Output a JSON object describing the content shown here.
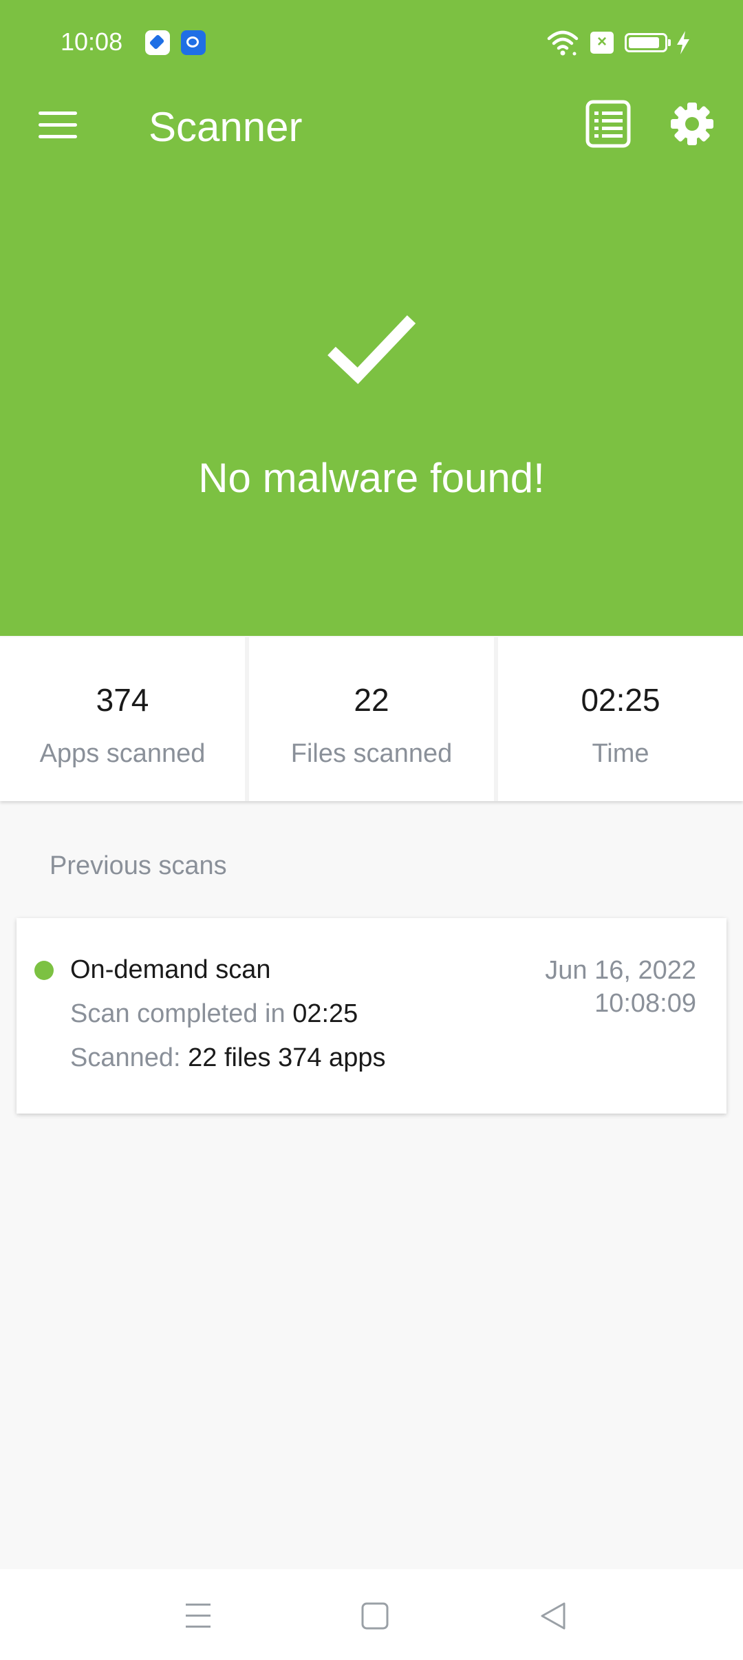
{
  "status_bar": {
    "time": "10:08",
    "notification_icons": [
      "app-notification-icon",
      "app-notification-icon"
    ],
    "sim_badge": "×",
    "icons": [
      "wifi-icon",
      "sim-icon",
      "battery-icon",
      "charging-icon"
    ]
  },
  "app_bar": {
    "title": "Scanner",
    "icons": [
      "menu-icon",
      "log-list-icon",
      "settings-gear-icon"
    ]
  },
  "result": {
    "icon": "checkmark-icon",
    "message": "No malware found!"
  },
  "stats": [
    {
      "value": "374",
      "label": "Apps scanned"
    },
    {
      "value": "22",
      "label": "Files scanned"
    },
    {
      "value": "02:25",
      "label": "Time"
    }
  ],
  "previous_scans": {
    "title": "Previous scans",
    "items": [
      {
        "type": "On-demand scan",
        "completed_prefix": "Scan completed in ",
        "completed_time": "02:25",
        "scanned_prefix": "Scanned: ",
        "scanned_detail": "22 files 374 apps",
        "date": "Jun 16, 2022",
        "time": "10:08:09"
      }
    ]
  },
  "nav_bar": {
    "icons": [
      "recents-icon",
      "home-icon",
      "back-icon"
    ]
  },
  "colors": {
    "brand_green": "#7cc142",
    "text_primary": "#1a1a1a",
    "text_secondary": "#8a9099",
    "background": "#f8f8f8"
  }
}
